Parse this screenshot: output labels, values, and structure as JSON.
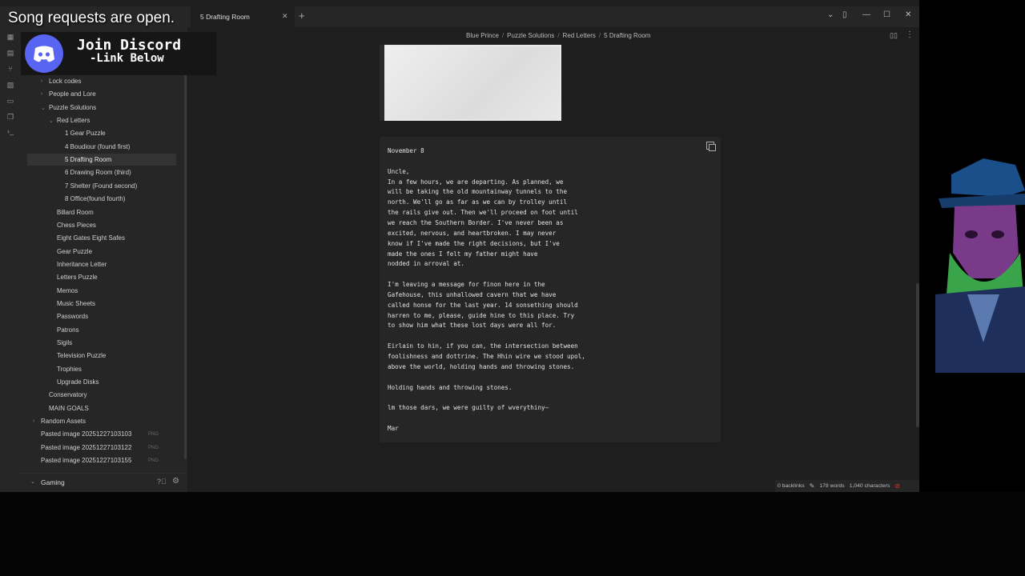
{
  "overlay": {
    "song_text": "Song requests are open.",
    "discord_line1": "Join Discord",
    "discord_line2": "-Link Below"
  },
  "tab": {
    "title": "5 Drafting Room"
  },
  "sidebar": {
    "items": [
      {
        "label": "Lock codes",
        "level": 1,
        "collapsed": true
      },
      {
        "label": "People and Lore",
        "level": 1,
        "collapsed": true
      },
      {
        "label": "Puzzle Solutions",
        "level": 1,
        "expanded": true
      },
      {
        "label": "Red Letters",
        "level": 2,
        "expanded": true
      },
      {
        "label": "1 Gear Puzzle",
        "level": 3
      },
      {
        "label": "4 Boudiour (found first)",
        "level": 3
      },
      {
        "label": "5 Drafting Room",
        "level": 3,
        "active": true
      },
      {
        "label": "6 Drawing Room (third)",
        "level": 3
      },
      {
        "label": "7 Shelter (Found second)",
        "level": 3
      },
      {
        "label": "8 Office(found fourth)",
        "level": 3
      },
      {
        "label": "Billard Room",
        "level": 2
      },
      {
        "label": "Chess Pieces",
        "level": 2
      },
      {
        "label": "Eight Gates Eight Safes",
        "level": 2
      },
      {
        "label": "Gear Puzzle",
        "level": 2
      },
      {
        "label": "Inheritance Letter",
        "level": 2
      },
      {
        "label": "Letters Puzzle",
        "level": 2
      },
      {
        "label": "Memos",
        "level": 2
      },
      {
        "label": "Music Sheets",
        "level": 2
      },
      {
        "label": "Passwords",
        "level": 2
      },
      {
        "label": "Patrons",
        "level": 2
      },
      {
        "label": "Sigils",
        "level": 2
      },
      {
        "label": "Television Puzzle",
        "level": 2
      },
      {
        "label": "Trophies",
        "level": 2
      },
      {
        "label": "Upgrade Disks",
        "level": 2
      },
      {
        "label": "Conservatory",
        "level": 1
      },
      {
        "label": "MAIN GOALS",
        "level": 1
      },
      {
        "label": "Random Assets",
        "level": 0,
        "collapsed": true
      },
      {
        "label": "Pasted image 20251227103103",
        "level": 0,
        "tag": "PNG"
      },
      {
        "label": "Pasted image 20251227103122",
        "level": 0,
        "tag": "PNG"
      },
      {
        "label": "Pasted image 20251227103155",
        "level": 0,
        "tag": "PNG"
      }
    ],
    "vault_name": "Gaming"
  },
  "breadcrumb": [
    "Blue Prince",
    "Puzzle Solutions",
    "Red Letters",
    "5 Drafting Room"
  ],
  "note": {
    "lines": [
      "November 8",
      "",
      "Uncle,",
      "In a few hours, we are departing. As planned, we",
      "will be taking the old mountainway tunnels to the",
      "north. We'll go as far as we can by trolley until",
      "the rails give out. Then we'll proceed on foot until",
      "we reach the Southern Border. I've never been as",
      "excited, nervous, and heartbroken. I may never",
      "know if I've made the right decisions, but I've",
      "made the ones I felt my father might have",
      "nodded in arroval at.",
      "",
      "I'm leaving a message for finon here in the",
      "Gafehouse, this unhallowed cavern that we have",
      "called honse for the last year. 14 sonsething should",
      "harren to me, please, guide hine to this place. Try",
      "to show him what these lost days were all for.",
      "",
      "Eirlain to hin, if you can, the intersection between",
      "foolishness and dottrine. The Hhin wire we stood upol,",
      "above the world, holding hands and throwing stones.",
      "",
      "Holding hands and throwing stones.",
      "",
      "lm those dars, we were guilty of wverythiny—",
      "",
      "Mar"
    ]
  },
  "status": {
    "backlinks": "0 backlinks",
    "words": "178 words",
    "characters": "1,040 characters"
  }
}
